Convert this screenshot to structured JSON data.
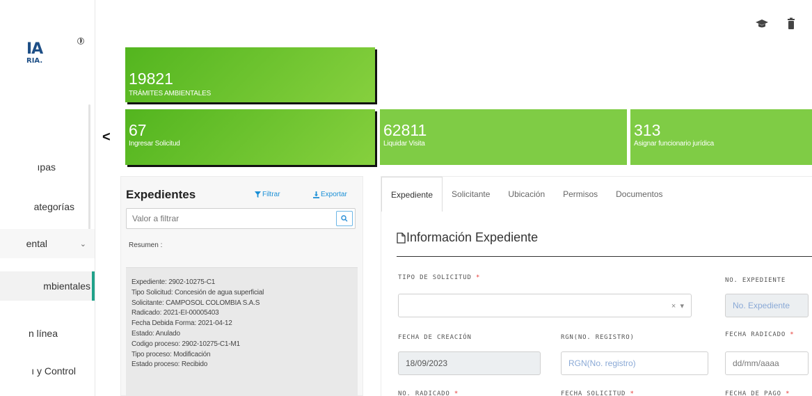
{
  "sidebar": {
    "logo_main": "IA",
    "logo_sub": "RIA.",
    "items": [
      {
        "label": "ıpas"
      },
      {
        "label": "ategorías"
      },
      {
        "label": "ental"
      },
      {
        "label": "mbientales"
      },
      {
        "label": "n línea"
      },
      {
        "label": "ı y Control"
      }
    ]
  },
  "nav": {
    "collapse_glyph": "<"
  },
  "cards": {
    "main": {
      "value": "19821",
      "label": "TRÁMITES AMBIENTALES"
    },
    "ingresar": {
      "value": "67",
      "label": "Ingresar Solicitud"
    },
    "liquidar": {
      "value": "62811",
      "label": "Liquidar Visita"
    },
    "asignar": {
      "value": "313",
      "label": "Asignar funcionario jurídica"
    }
  },
  "expedientes": {
    "title": "Expedientes",
    "filter_label": "Filtrar",
    "export_label": "Exportar",
    "search_placeholder": "Valor a filtrar",
    "resumen_label": "Resumen :",
    "summary": [
      "Expediente: 2902-10275-C1",
      "Tipo Solicitud: Concesión de agua superficial",
      "Solicitante: CAMPOSOL COLOMBIA S.A.S",
      "Radicado: 2021-EI-00005403",
      "Fecha Debida Forma: 2021-04-12",
      "Estado: Anulado",
      "Codigo proceso: 2902-10275-C1-M1",
      "Tipo proceso: Modificación",
      "Estado proceso: Recibido"
    ]
  },
  "form": {
    "tabs": [
      "Expediente",
      "Solicitante",
      "Ubicación",
      "Permisos",
      "Documentos"
    ],
    "section_title": "Información Expediente",
    "fields": {
      "tipo_solicitud": {
        "label": "TIPO DE SOLICITUD",
        "req": "*",
        "value": "",
        "clear": "×",
        "caret": "▾"
      },
      "no_expediente": {
        "label": "NO. EXPEDIENTE",
        "placeholder": "No. Expediente"
      },
      "fecha_creacion": {
        "label": "FECHA DE CREACIÓN",
        "value": "18/09/2023"
      },
      "rgn": {
        "label": "RGN(NO. REGISTRO)",
        "placeholder": "RGN(No. registro)"
      },
      "fecha_radicado": {
        "label": "FECHA RADICADO",
        "req": "*",
        "placeholder": "dd/mm/aaaa"
      },
      "no_radicado": {
        "label": "NO. RADICADO",
        "req": "*"
      },
      "fecha_solicitud": {
        "label": "FECHA SOLICITUD",
        "req": "*"
      },
      "fecha_pago": {
        "label": "FECHA DE PAGO",
        "req": "*"
      }
    }
  },
  "colors": {
    "card_green": "#7fcc45",
    "card_dark_green": "#53b51f",
    "link_blue": "#1a8fd6",
    "active_accent": "#21a28a",
    "required_red": "#e53935"
  },
  "icons": {
    "top_right": [
      "graduation-cap-icon",
      "trash-icon"
    ],
    "filter": "filter-icon",
    "export": "download-icon",
    "search": "search-icon",
    "section": "document-icon"
  }
}
